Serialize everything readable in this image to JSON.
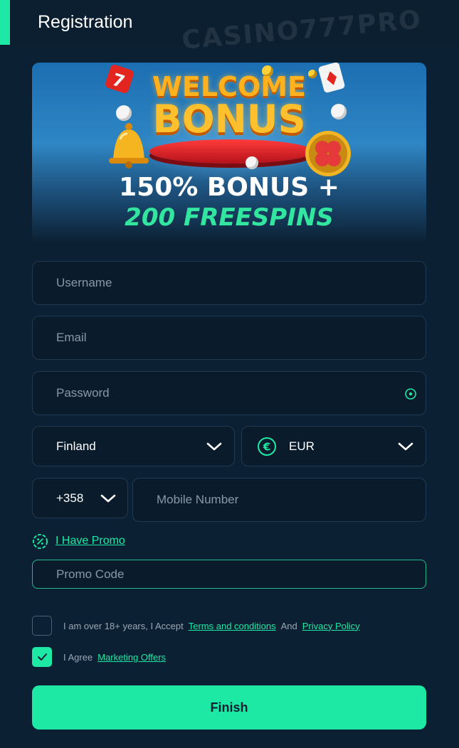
{
  "header": {
    "title": "Registration",
    "watermark": "CASINO777PRO"
  },
  "banner": {
    "headline_top": "WELCOME",
    "headline_main": "BONUS",
    "offer_line1": "150% BONUS +",
    "offer_line2": "200 FREESPINS"
  },
  "form": {
    "username_placeholder": "Username",
    "email_placeholder": "Email",
    "password_placeholder": "Password",
    "country_value": "Finland",
    "currency_value": "EUR",
    "currency_symbol": "€",
    "phone_code": "+358",
    "mobile_placeholder": "Mobile Number",
    "promo_toggle_label": "I Have Promo",
    "promo_placeholder": "Promo Code"
  },
  "consents": {
    "age_text": "I am over 18+ years, I Accept",
    "terms_link": "Terms and conditions",
    "and_text": "And",
    "privacy_link": "Privacy Policy",
    "age_checked": false,
    "marketing_text": "I Agree",
    "marketing_link": "Marketing Offers",
    "marketing_checked": true
  },
  "actions": {
    "finish_label": "Finish"
  },
  "colors": {
    "accent": "#1de9a5",
    "background": "#0c2033",
    "field_border": "#1f3a52"
  },
  "icons": {
    "password_toggle": "eye-icon",
    "currency": "euro-circle-icon",
    "promo": "percent-badge-icon",
    "dropdown": "chevron-down-icon",
    "check": "check-icon"
  }
}
